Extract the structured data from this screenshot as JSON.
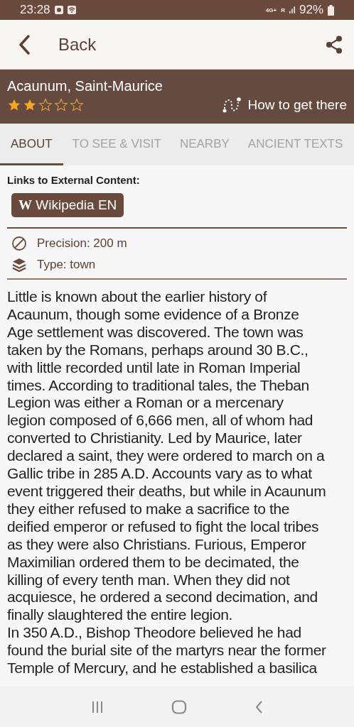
{
  "status_bar": {
    "time": "23:28",
    "network": "4G+",
    "roaming": "R",
    "battery": "92%"
  },
  "app_bar": {
    "back_label": "Back"
  },
  "header": {
    "title": "Acaunum, Saint-Maurice",
    "stars": 2,
    "directions_label": "How to get there"
  },
  "tabs": [
    {
      "label": "ABOUT",
      "selected": true
    },
    {
      "label": "TO SEE & VISIT",
      "selected": false
    },
    {
      "label": "NEARBY",
      "selected": false
    },
    {
      "label": "ANCIENT TEXTS",
      "selected": false
    }
  ],
  "links": {
    "heading": "Links to External Content:",
    "buttons": [
      {
        "icon_letter": "W",
        "label": "Wikipedia EN"
      }
    ]
  },
  "facts": [
    {
      "kind": "precision",
      "text": "Precision: 200 m"
    },
    {
      "kind": "type",
      "text": "Type: town"
    }
  ],
  "paragraphs": [
    {
      "lines": [
        "Little is known about the earlier history of",
        "Acaunum, though some evidence of a Bronze",
        "Age settlement was discovered. The town was",
        "taken by the Romans, perhaps around 30 B.C.,",
        "with little recorded until late in Roman Imperial",
        "times. According to traditional tales, the Theban",
        "Legion was either a Roman or a mercenary",
        "legion composed of 6,666 men, all of whom had",
        "converted to Christianity. Led by Maurice, later",
        "declared a saint, they were ordered to march on a",
        "Gallic tribe in 285 A.D. Accounts vary as to what",
        "event triggered their deaths, but while in Acaunum",
        "they either refused to make a sacrifice to the",
        "deified emperor or refused to fight the local tribes",
        "as they were also Christians. Furious, Emperor",
        "Maximilian ordered them to be decimated, the",
        "killing of every tenth man. When they did not",
        "acquiesce, he ordered a second decimation, and",
        "finally slaughtered the entire legion."
      ]
    },
    {
      "lines": [
        "In 350 A.D., Bishop Theodore believed he had",
        "found the burial site of the martyrs near the former",
        "Temple of Mercury, and he established a basilica"
      ]
    }
  ]
}
